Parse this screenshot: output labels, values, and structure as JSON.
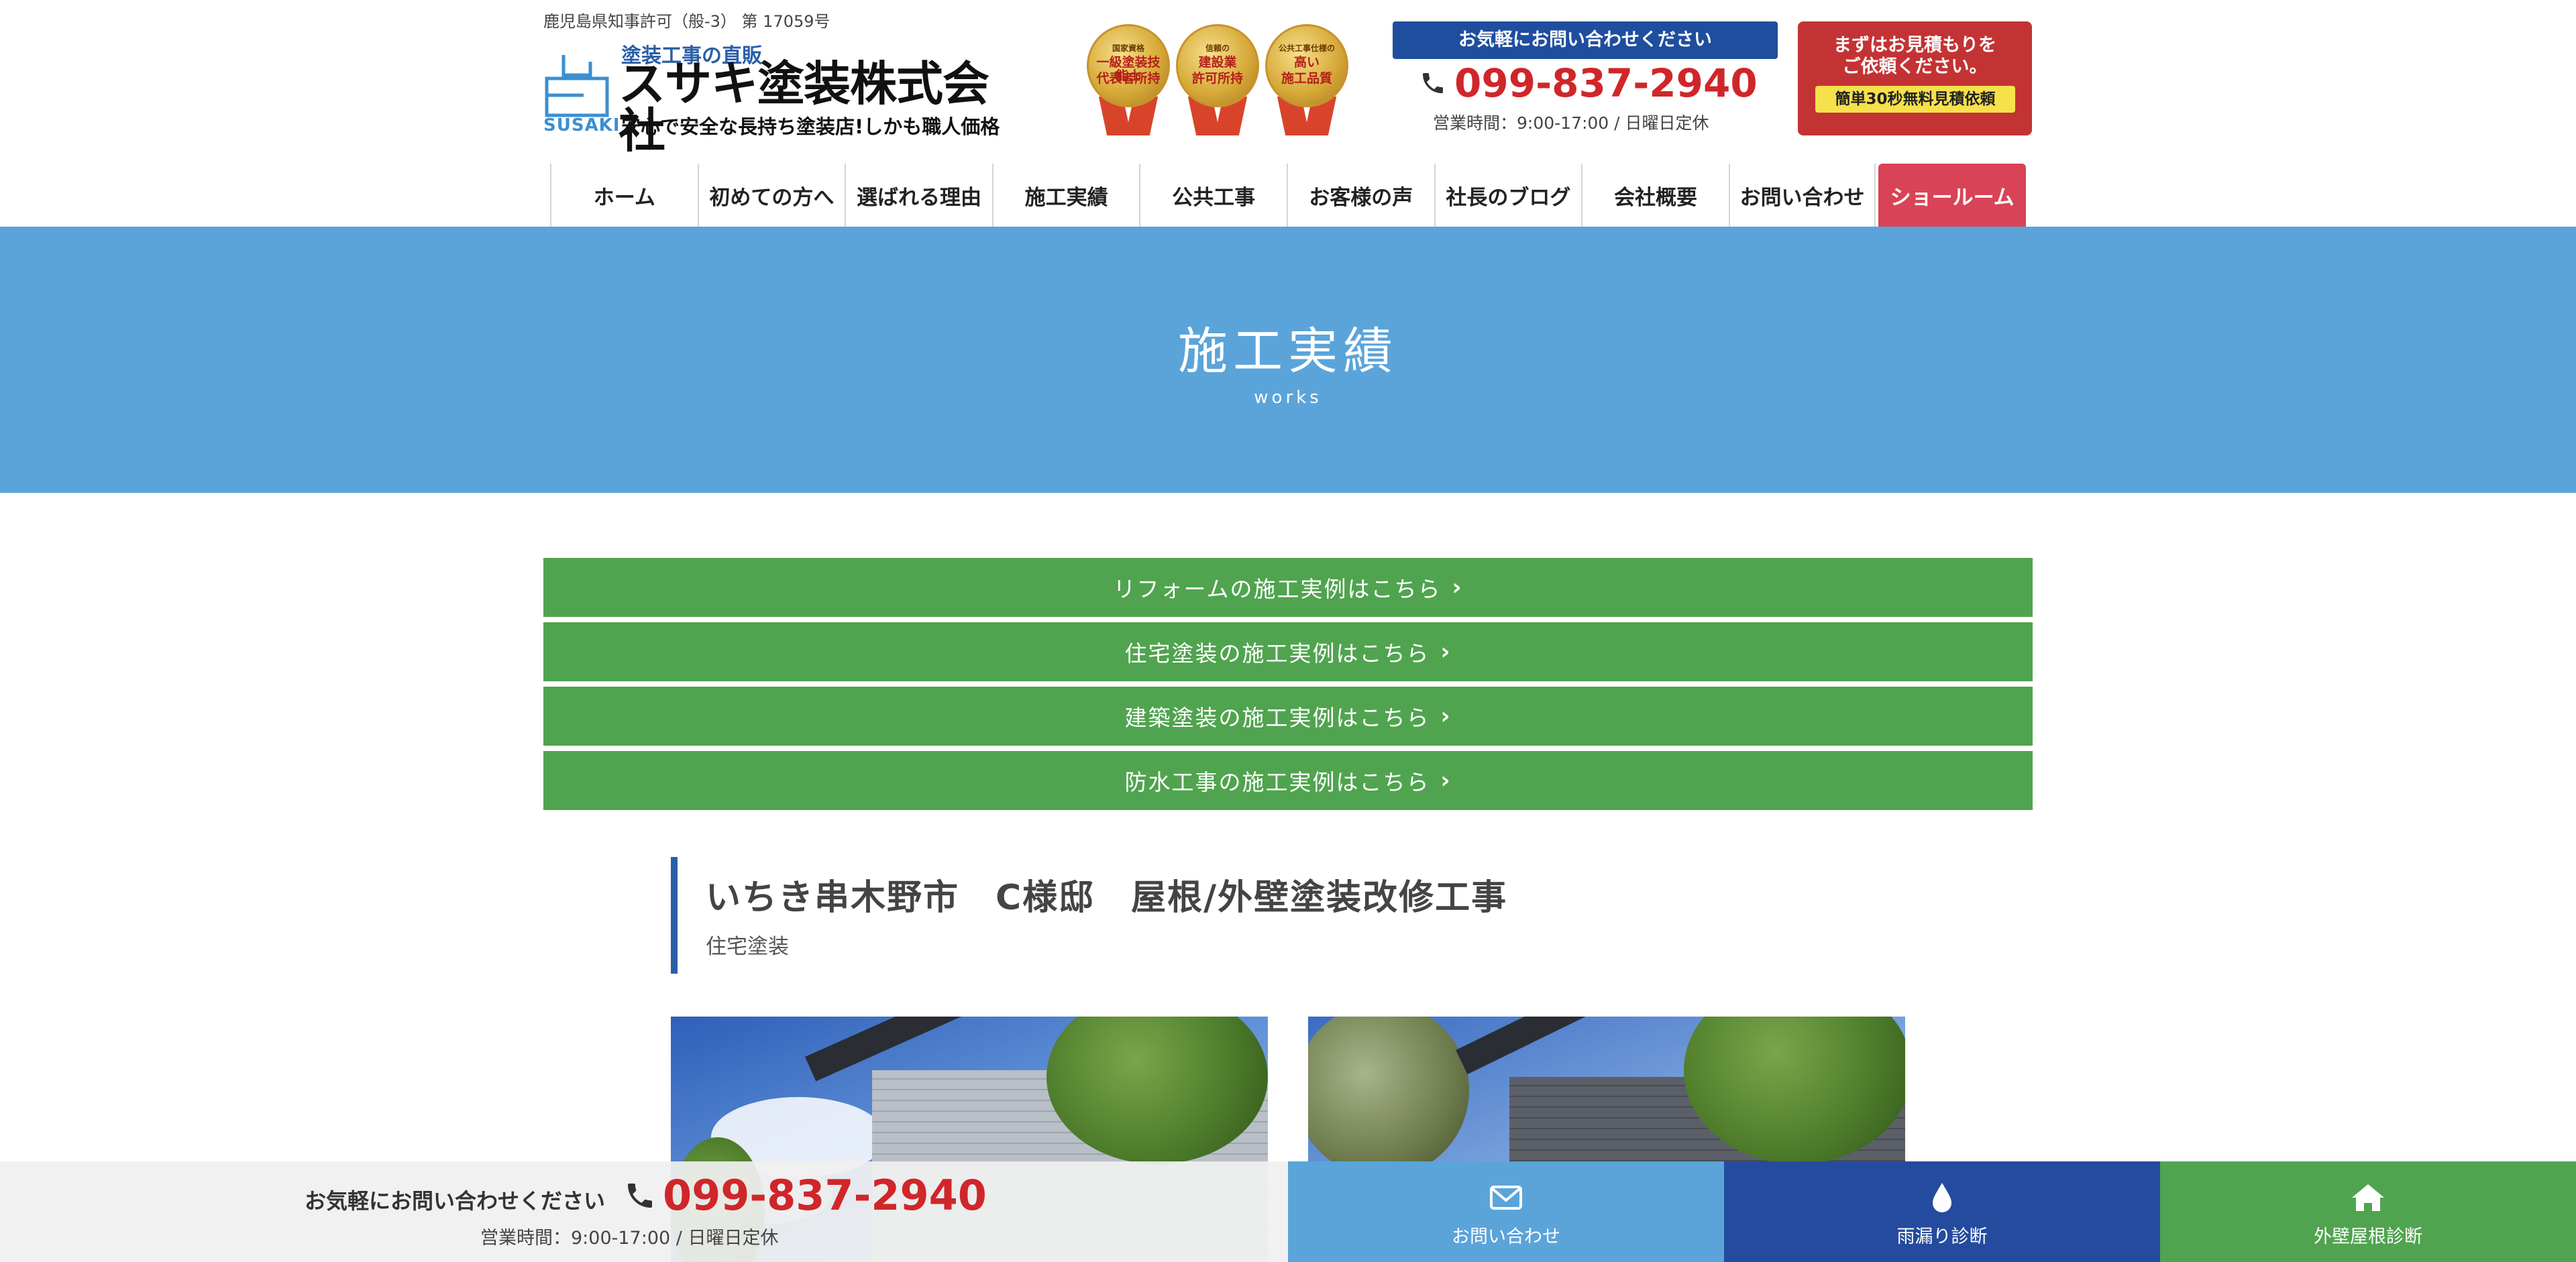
{
  "header": {
    "license": "鹿児島県知事許可（般-3） 第 17059号",
    "logo": {
      "tagline_top": "塗装工事の直販",
      "company_name": "スサキ塗装株式会社",
      "tagline_bottom": "安心で安全な長持ち塗装店!しかも職人価格",
      "logo_en": "SUSAKI"
    },
    "medals": [
      {
        "top": "国家資格",
        "line1": "一級塗装技能士",
        "line2": "代表者所持"
      },
      {
        "top": "信頼の",
        "line1": "建設業",
        "line2": "許可所持"
      },
      {
        "top": "公共工事仕様の",
        "line1": "高い",
        "line2": "施工品質"
      }
    ],
    "contact": {
      "caption": "お気軽にお問い合わせください",
      "phone": "099-837-2940",
      "hours": "営業時間：9:00-17:00 / 日曜日定休"
    },
    "estimate": {
      "line1": "まずはお見積もりを",
      "line2": "ご依頼ください。",
      "pill": "簡単30秒無料見積依頼"
    }
  },
  "nav": {
    "items": [
      "ホーム",
      "初めての方へ",
      "選ばれる理由",
      "施工実績",
      "公共工事",
      "お客様の声",
      "社長のブログ",
      "会社概要",
      "お問い合わせ"
    ],
    "showroom": "ショールーム"
  },
  "hero": {
    "title": "施工実績",
    "subtitle": "works"
  },
  "categories": [
    "リフォームの施工実例はこちら",
    "住宅塗装の施工実例はこちら",
    "建築塗装の施工実例はこちら",
    "防水工事の施工実例はこちら"
  ],
  "work": {
    "title": "いちき串木野市　C様邸　屋根/外壁塗装改修工事",
    "category": "住宅塗装"
  },
  "footer": {
    "caption": "お気軽にお問い合わせください",
    "phone": "099-837-2940",
    "hours": "営業時間：9:00-17:00 / 日曜日定休",
    "buttons": {
      "mail": "お問い合わせ",
      "leak": "雨漏り診断",
      "roof": "外壁屋根診断"
    }
  },
  "colors": {
    "hero_bg": "#5ba4da",
    "category_green": "#50a44f",
    "phone_red": "#d0262a",
    "navy": "#1f4e9e",
    "showroom_pink": "#d94357"
  },
  "icons": [
    "phone-icon",
    "chevron-right-icon",
    "mail-icon",
    "water-drop-icon",
    "home-icon"
  ]
}
